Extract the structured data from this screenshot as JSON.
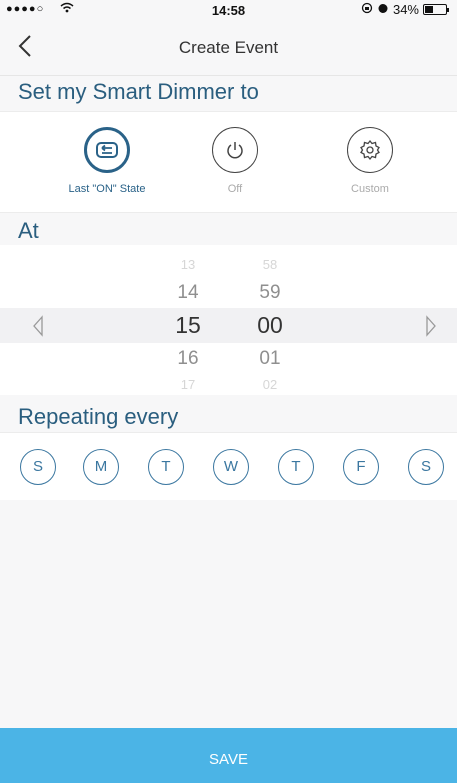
{
  "status_bar": {
    "signal": "●●●●○",
    "wifi_icon": "wifi-icon",
    "time": "14:58",
    "battery": "34%",
    "battery_level": 0.34
  },
  "header": {
    "title": "Create Event",
    "back_icon": "chevron-left-icon"
  },
  "sections": {
    "state_title": "Set my Smart Dimmer to",
    "time_title": "At",
    "repeat_title": "Repeating every"
  },
  "modes": [
    {
      "label": "Last \"ON\" State",
      "icon": "last-state-icon",
      "selected": true
    },
    {
      "label": "Off",
      "icon": "power-icon",
      "selected": false
    },
    {
      "label": "Custom",
      "icon": "gear-icon",
      "selected": false
    }
  ],
  "time_picker": {
    "hours": [
      "13",
      "14",
      "15",
      "16",
      "17"
    ],
    "minutes": [
      "58",
      "59",
      "00",
      "01",
      "02"
    ],
    "selected_hour": "15",
    "selected_minute": "00"
  },
  "days": [
    "S",
    "M",
    "T",
    "W",
    "T",
    "F",
    "S"
  ],
  "footer": {
    "save_label": "SAVE"
  },
  "colors": {
    "accent": "#2a5e7f",
    "day_ring": "#3b77a0",
    "save_bg": "#4bb4e6",
    "background": "#f7f7f8"
  }
}
